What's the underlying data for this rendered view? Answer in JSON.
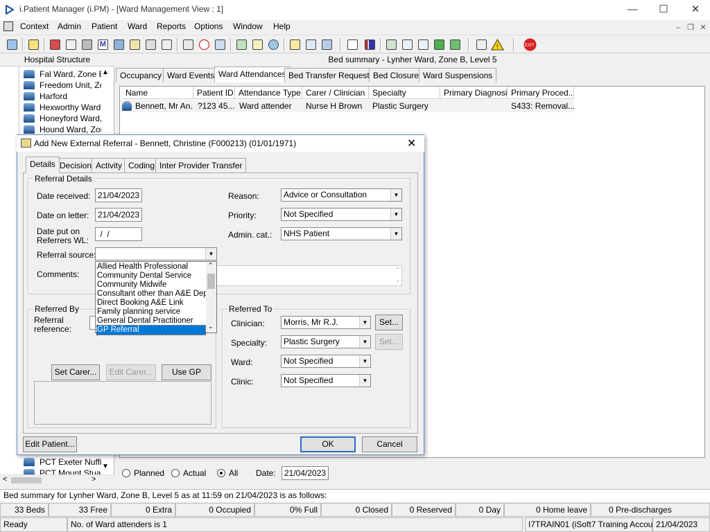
{
  "window": {
    "title": "i.Patient Manager (i.PM) - [Ward Management View : 1]"
  },
  "menus": [
    "Context",
    "Admin",
    "Patient",
    "Ward",
    "Reports",
    "Options",
    "Window",
    "Help"
  ],
  "left_panel": {
    "header": "Hospital Structure",
    "items": [
      "Fal Ward, Zone E",
      "Freedom Unit, Zo",
      "Harford",
      "Hexworthy Ward,",
      "Honeyford Ward,",
      "Hound Ward, Zon"
    ],
    "bottom_items": [
      "PCT Exeter Nuffie",
      "PCT Mount Stuar"
    ]
  },
  "main": {
    "bed_summary_title": "Bed summary - Lynher Ward, Zone B, Level 5",
    "tabs": [
      "Occupancy",
      "Ward Events",
      "Ward Attendances",
      "Bed Transfer Requests",
      "Bed Closures",
      "Ward Suspensions"
    ],
    "active_tab": "Ward Attendances",
    "columns": [
      "Name",
      "Patient ID",
      "Attendance Type",
      "Carer / Clinician",
      "Specialty",
      "Primary Diagnosis",
      "Primary Proced..."
    ],
    "rows": [
      {
        "name": "Bennett, Mr An...",
        "patient_id": "?123 45...",
        "attendance_type": "Ward attender",
        "carer": "Nurse H Brown",
        "specialty": "Plastic Surgery",
        "diagnosis": "",
        "procedure": "S433: Removal..."
      }
    ],
    "filter": {
      "planned": "Planned",
      "actual": "Actual",
      "all": "All",
      "date_label": "Date:",
      "date_value": "21/04/2023",
      "selected": "All"
    }
  },
  "status": {
    "summary_line": "Bed summary for Lynher Ward, Zone B, Level 5 as at 11:59 on 21/04/2023 is as follows:",
    "counts": [
      "33 Beds",
      "33 Free",
      "0 Extra",
      "0 Occupied",
      "0% Full",
      "0 Closed",
      "0 Reserved",
      "0 Day",
      "0 Home leave",
      "0 Pre-discharges"
    ],
    "ready": "Ready",
    "message": "No. of Ward attenders is 1",
    "user": "I7TRAIN01 (iSoft7 Training Account)",
    "date": "21/04/2023"
  },
  "dialog": {
    "title": "Add New External Referral - Bennett, Christine (F000213) (01/01/1971)",
    "tabs": [
      "Details",
      "Decision",
      "Activity",
      "Coding",
      "Inter Provider Transfer"
    ],
    "active_tab": "Details",
    "referral_details": {
      "group_label": "Referral Details",
      "date_received_label": "Date received:",
      "date_received": "21/04/2023",
      "date_on_letter_label": "Date on letter:",
      "date_on_letter": "21/04/2023",
      "date_put_label": "Date put on Referrers WL:",
      "date_put_value": " /  /",
      "referral_source_label": "Referral source:",
      "referral_source_value": "",
      "comments_label": "Comments:",
      "reason_label": "Reason:",
      "reason_value": "Advice or Consultation",
      "priority_label": "Priority:",
      "priority_value": "Not Specified",
      "admin_cat_label": "Admin. cat.:",
      "admin_cat_value": "NHS Patient"
    },
    "referral_source_options": [
      "Allied Health Professional",
      "Community Dental Service",
      "Community Midwife",
      "Consultant other than A&E Dept",
      "Direct Booking A&E Link",
      "Family planning service",
      "General Dental Practitioner",
      "GP Referral"
    ],
    "referral_source_selected": "GP Referral",
    "referred_by": {
      "group_label": "Referred By",
      "reference_label": "Referral reference:",
      "set_carer": "Set Carer...",
      "edit_carer": "Edit Carer...",
      "use_gp": "Use GP"
    },
    "referred_to": {
      "group_label": "Referred To",
      "clinician_label": "Clinician:",
      "clinician_value": "Morris, Mr R.J.",
      "specialty_label": "Specialty:",
      "specialty_value": "Plastic Surgery",
      "ward_label": "Ward:",
      "ward_value": "Not Specified",
      "clinic_label": "Clinic:",
      "clinic_value": "Not Specified",
      "set_label": "Set..."
    },
    "edit_patient": "Edit Patient...",
    "ok": "OK",
    "cancel": "Cancel"
  }
}
